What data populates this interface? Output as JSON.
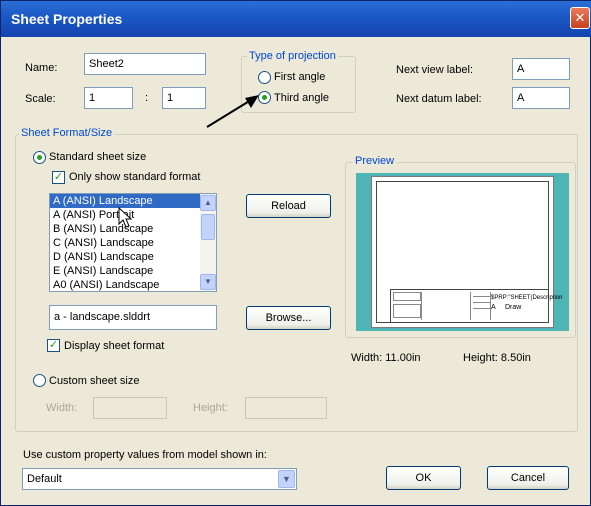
{
  "dialog": {
    "title": "Sheet Properties",
    "close_glyph": "✕"
  },
  "name_field": {
    "label": "Name:",
    "value": "Sheet2"
  },
  "scale_field": {
    "label": "Scale:",
    "numerator": "1",
    "separator": ":",
    "denominator": "1"
  },
  "projection": {
    "title": "Type of projection",
    "first_angle": "First angle",
    "third_angle": "Third angle",
    "selected": "third_angle"
  },
  "next_view": {
    "label": "Next view label:",
    "value": "A"
  },
  "next_datum": {
    "label": "Next datum label:",
    "value": "A"
  },
  "sheet_format": {
    "title": "Sheet Format/Size",
    "standard_label": "Standard sheet size",
    "only_standard_label": "Only show standard format",
    "sizes": [
      "A (ANSI) Landscape",
      "A (ANSI) Portrait",
      "B (ANSI) Landscape",
      "C (ANSI) Landscape",
      "D (ANSI) Landscape",
      "E (ANSI) Landscape",
      "A0 (ANSI) Landscape"
    ],
    "selected_index": 0,
    "reload_label": "Reload",
    "format_file": "a - landscape.slddrt",
    "browse_label": "Browse...",
    "display_format_label": "Display sheet format",
    "custom_label": "Custom sheet size",
    "width_label": "Width:",
    "height_label": "Height:"
  },
  "preview": {
    "title": "Preview",
    "title_block_text": "$PRP:\"SHEET(Description",
    "sheet_letter": "A",
    "draw_text": "Draw",
    "width_text": "Width:  11.00in",
    "height_text": "Height:  8.50in"
  },
  "custom_property": {
    "label": "Use custom property values from model shown in:",
    "value": "Default"
  },
  "ok_label": "OK",
  "cancel_label": "Cancel",
  "colors": {
    "title_bar": "#1b57c4",
    "selection": "#316ac5",
    "preview_bg": "#4fb5b5",
    "group_title": "#0046d5"
  }
}
